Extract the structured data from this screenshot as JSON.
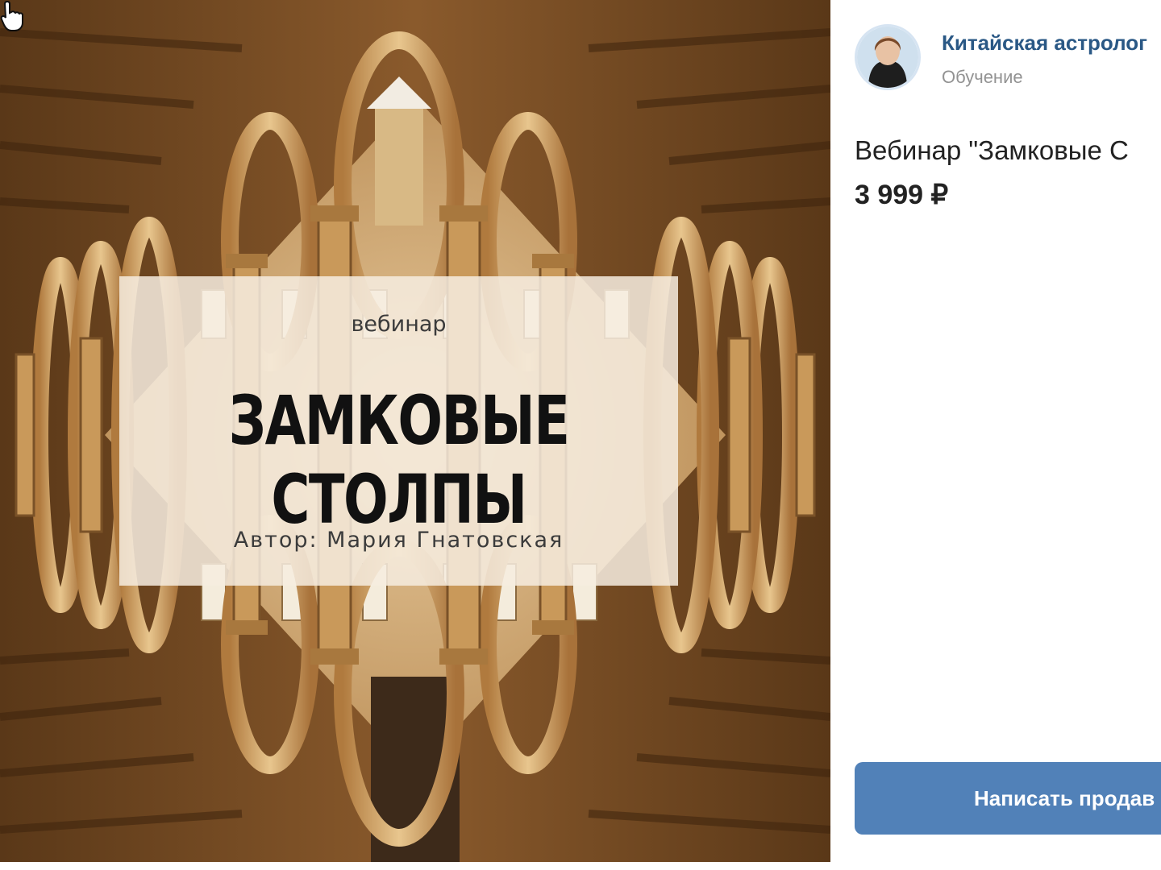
{
  "banner": {
    "kicker": "вебинар",
    "title": "ЗАМКОВЫЕ СТОЛПЫ",
    "author": "Автор: Мария Гнатовская"
  },
  "seller": {
    "name": "Китайская астролог",
    "category": "Обучение"
  },
  "product": {
    "title": "Вебинар \"Замковые С",
    "price": "3 999 ₽"
  },
  "actions": {
    "contact_label": "Написать продав"
  },
  "colors": {
    "accent": "#5181b8",
    "link": "#2a5885",
    "muted": "#939393",
    "text": "#222222"
  },
  "icons": {
    "cursor": "hand-pointer-icon"
  }
}
